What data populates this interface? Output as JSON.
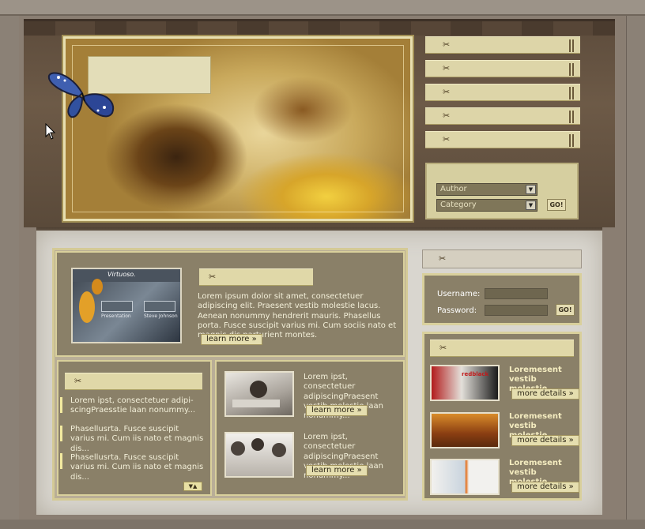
{
  "search": {
    "author_label": "Author",
    "category_label": "Category",
    "go_label": "GO!"
  },
  "featured": {
    "image_title": "Virtuoso.",
    "image_button_1": "Presentation",
    "image_button_2": "Steve Johnson",
    "text": "Lorem ipsum dolor sit amet, consectetuer adipiscing elit. Praesent vestib molestie lacus. Aenean nonummy hendrerit mauris. Phasellus porta. Fusce suscipit varius mi. Cum sociis nato et magnis dis parturient montes.",
    "button": "learn more »"
  },
  "list": {
    "items": [
      {
        "text": "Lorem ipst, consectetuer adipi-scingPraesstie laan nonummy..."
      },
      {
        "text": "Phasellusrta. Fusce suscipit varius mi. Cum iis nato et magnis dis..."
      },
      {
        "text": "Phasellusrta. Fusce suscipit varius mi. Cum iis nato et magnis dis..."
      }
    ],
    "scroll_label": "▼▲"
  },
  "articles": [
    {
      "text": "Lorem ipst, consectetuer adipiscingPraesent vestib molestie laan nonummy...",
      "button": "learn more »"
    },
    {
      "text": "Lorem ipst, consectetuer adipiscingPraesent vestib molestie laan nonummy...",
      "button": "learn more »"
    }
  ],
  "login": {
    "username_label": "Username:",
    "password_label": "Password:",
    "go_label": "GO!"
  },
  "news": [
    {
      "title": "Loremesent vestib molestie",
      "button": "more details »",
      "thumb_caption": "redblack"
    },
    {
      "title": "Loremesent vestib molestie",
      "button": "more details »"
    },
    {
      "title": "Loremesent vestib molestie",
      "button": "more details »"
    }
  ],
  "icons": {
    "clip": "paperclip-icon",
    "dropdown": "chevron-down-icon",
    "butterfly": "butterfly-icon",
    "cursor": "mouse-cursor-icon"
  },
  "colors": {
    "accent": "#d9d09c",
    "panel": "#8a8068",
    "text_light": "#f3efd9"
  }
}
